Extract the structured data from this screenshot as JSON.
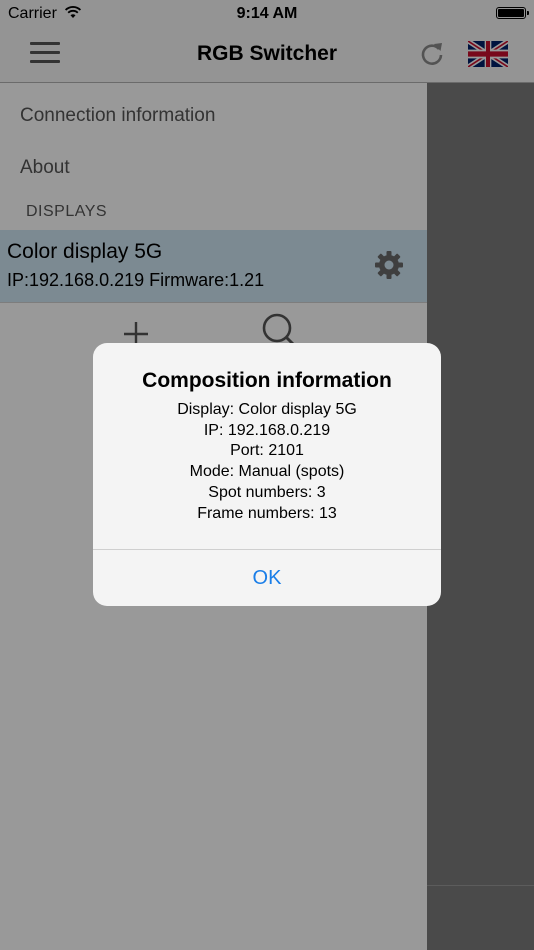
{
  "status_bar": {
    "carrier": "Carrier",
    "time": "9:14 AM",
    "wifi_icon": "wifi-icon",
    "battery_icon": "battery-icon"
  },
  "nav": {
    "title": "RGB Switcher",
    "menu_icon": "hamburger-menu-icon",
    "refresh_icon": "refresh-icon",
    "language_flag": "uk-flag-icon"
  },
  "menu": {
    "items": [
      {
        "label": "Connection information"
      },
      {
        "label": "About"
      }
    ],
    "section_header": "DISPLAYS",
    "displays": [
      {
        "name": "Color display 5G",
        "info": "IP:192.168.0.219 Firmware:1.21",
        "icon": "gear-icon"
      }
    ],
    "add_icon": "plus-icon",
    "search_icon": "search-icon"
  },
  "alert": {
    "title": "Composition information",
    "lines": [
      "Display: Color display 5G",
      "IP: 192.168.0.219",
      "Port: 2101",
      "Mode: Manual (spots)",
      "Spot numbers: 3",
      "Frame numbers: 13"
    ],
    "ok_label": "OK"
  },
  "colors": {
    "accent": "#1a7ee8",
    "selected_row": "#cfe6f4",
    "nav_bg": "#f7f7f7"
  }
}
